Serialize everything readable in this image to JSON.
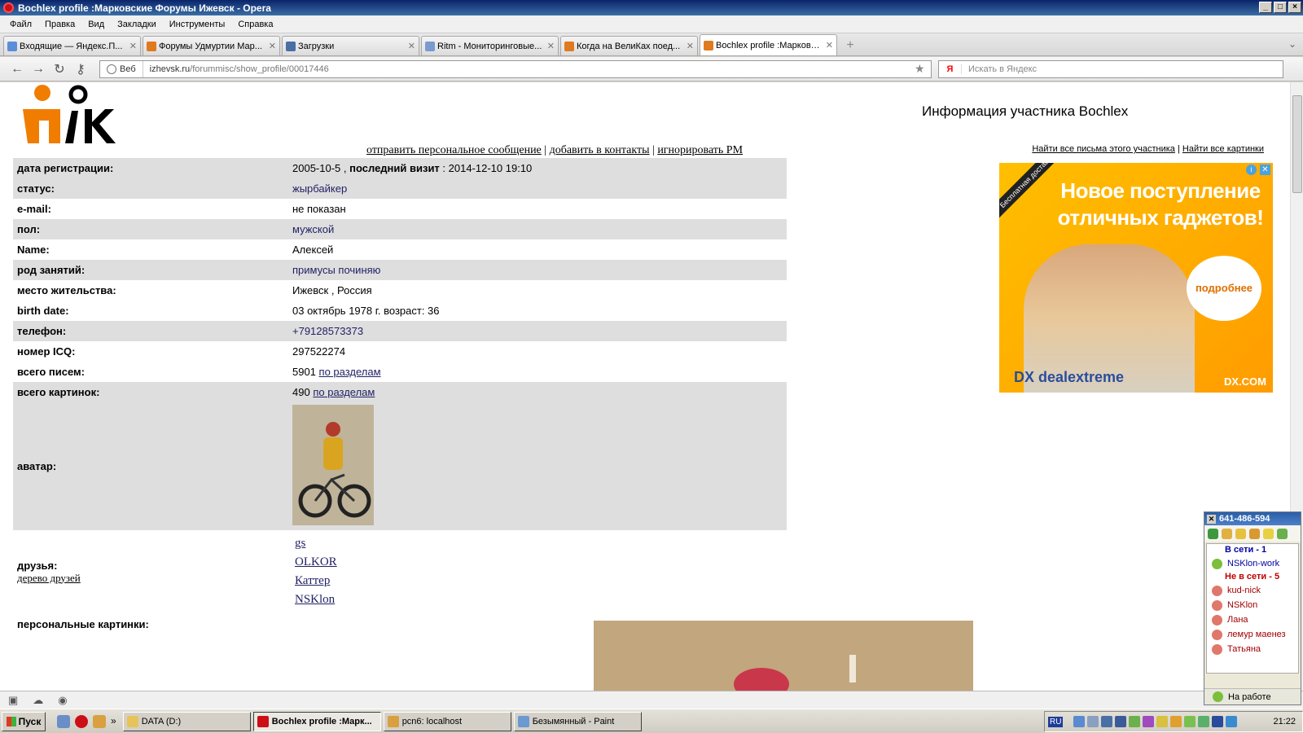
{
  "window": {
    "title": "Bochlex profile :Марковские Форумы Ижевск - Opera"
  },
  "menu": [
    "Файл",
    "Правка",
    "Вид",
    "Закладки",
    "Инструменты",
    "Справка"
  ],
  "tabs": [
    {
      "label": "Входящие — Яндекс.П...",
      "color": "#5a8fd8"
    },
    {
      "label": "Форумы Удмуртии Мар...",
      "color": "#e07a20"
    },
    {
      "label": "Загрузки",
      "color": "#4a6fa5"
    },
    {
      "label": "Ritm - Мониторинговые...",
      "color": "#7a9ad0"
    },
    {
      "label": "Когда на ВелиКах поед...",
      "color": "#e07a20"
    },
    {
      "label": "Bochlex profile :Марковс...",
      "color": "#e07a20",
      "active": true
    }
  ],
  "addressbar": {
    "security_label": "Веб",
    "url_domain": "izhevsk.ru",
    "url_path": "/forummisc/show_profile/00017446",
    "search_placeholder": "Искать в Яндекс"
  },
  "page": {
    "title": "Информация участника Bochlex",
    "actions": {
      "send_pm": "отправить персональное сообщение",
      "add_contact": "добавить в контакты",
      "ignore_pm": "игнорировать PM",
      "separator": "|"
    },
    "find_links": {
      "all_posts": "Найти все письма этого участника",
      "all_images": "Найти все картинки",
      "separator": "|"
    },
    "profile": {
      "registration_label": "дата регистрации:",
      "registration_date": "2005-10-5",
      "last_visit_label": "последний визит",
      "last_visit_value": "2014-12-10 19:10",
      "status_label": "статус:",
      "status_value": "жырбайкер",
      "email_label": "e-mail:",
      "email_value": "не показан",
      "gender_label": "пол:",
      "gender_value": "мужской",
      "name_label": "Name:",
      "name_value": "Алексей",
      "occupation_label": "род занятий:",
      "occupation_value": "примусы починяю",
      "residence_label": "место жительства:",
      "residence_value": "Ижевск , Россия",
      "birth_label": "birth date:",
      "birth_value": "03 октябрь 1978 г. возраст: 36",
      "phone_label": "телефон:",
      "phone_value": "+79128573373",
      "icq_label": "номер ICQ:",
      "icq_value": "297522274",
      "posts_label": "всего писем:",
      "posts_count": "5901",
      "posts_link": "по разделам",
      "pics_label": "всего картинок:",
      "pics_count": "490",
      "pics_link": "по разделам",
      "avatar_label": "аватар:",
      "friends_label": "друзья:",
      "friends_tree_link": "дерево друзей",
      "friends": [
        "gs",
        "OLKOR",
        "Каттер",
        "NSKlon"
      ],
      "personal_pics_label": "персональные картинки:"
    },
    "ad": {
      "corner": "Бесплатная доставка",
      "headline": "Новое поступление отличных гаджетов!",
      "bubble": "подробнее",
      "brand": "DX dealextreme",
      "site": "DX.COM"
    }
  },
  "icq": {
    "title": "641-486-594",
    "online_group": "В сети - 1",
    "online": [
      "NSKlon-work"
    ],
    "offline_group": "Не в сети - 5",
    "offline": [
      "kud-nick",
      "NSKlon",
      "Лана",
      "лемур маенез",
      "Татьяна"
    ],
    "status": "На работе"
  },
  "taskbar": {
    "start": "Пуск",
    "tasks": [
      {
        "label": "DATA (D:)",
        "color": "#e6c45a"
      },
      {
        "label": "Bochlex profile :Марк...",
        "color": "#cc0f16",
        "active": true
      },
      {
        "label": "pcn6: localhost",
        "color": "#d8a040"
      },
      {
        "label": "Безымянный - Paint",
        "color": "#6a9ad0"
      }
    ],
    "language": "RU",
    "clock": "21:22"
  }
}
